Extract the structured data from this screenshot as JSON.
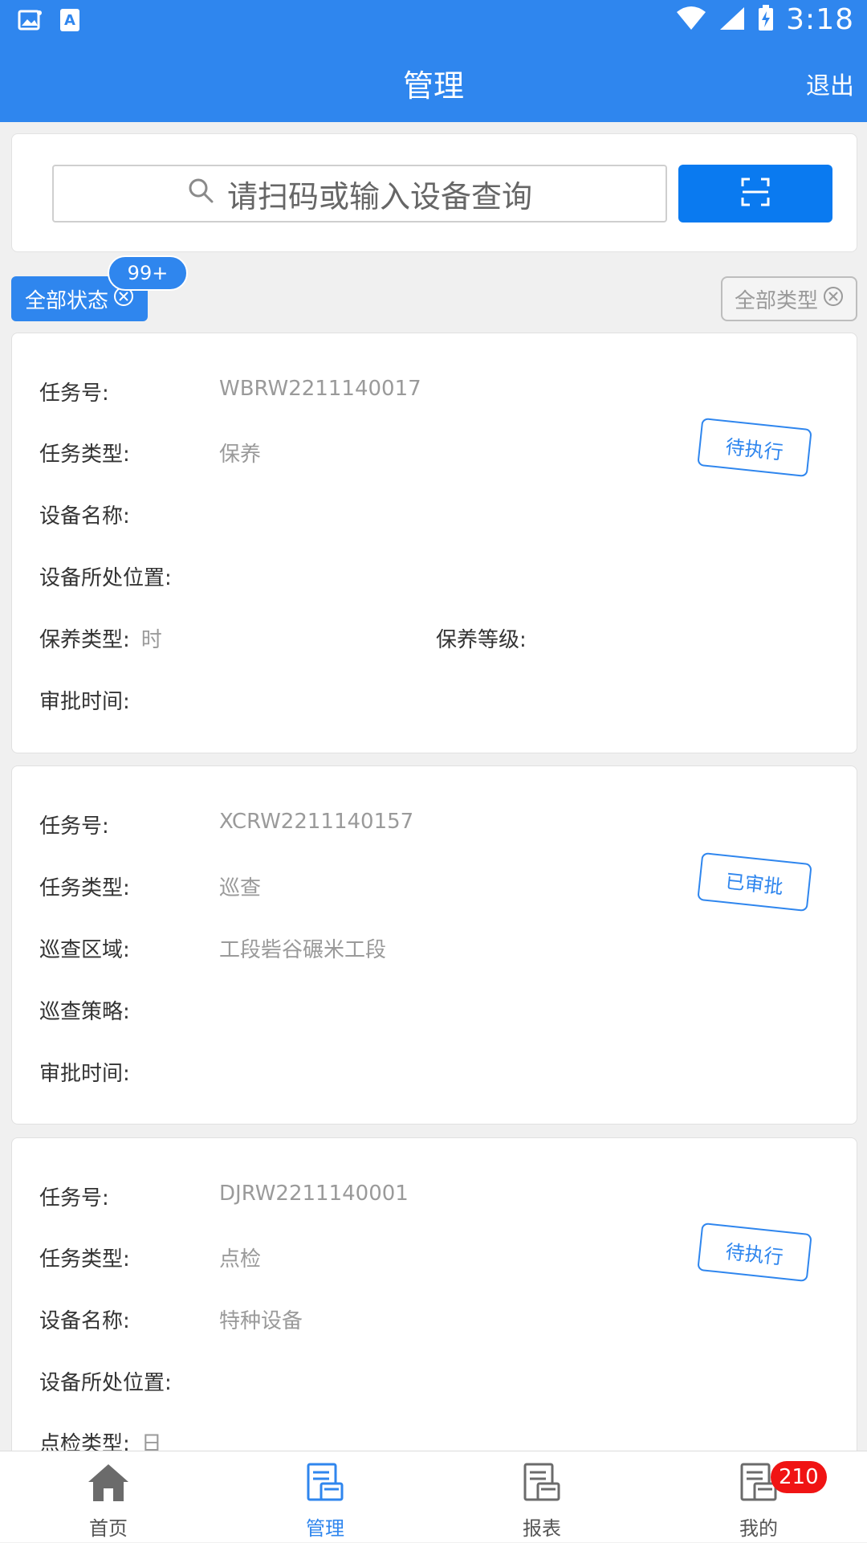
{
  "status_bar": {
    "time": "3:18",
    "icons": [
      "gallery-icon",
      "app-store-icon",
      "wifi-icon",
      "cellular-signal-icon",
      "battery-charging-icon"
    ]
  },
  "header": {
    "title": "管理",
    "logout_label": "退出"
  },
  "search": {
    "placeholder": "请扫码或输入设备查询",
    "icon": "search-icon",
    "scan_icon": "scan-frame-icon"
  },
  "filters": {
    "status_chip": "全部状态",
    "status_badge": "99+",
    "type_chip": "全部类型"
  },
  "tasks": [
    {
      "fields": [
        {
          "label": "任务号:",
          "value": "WBRW2211140017"
        },
        {
          "label": "任务类型:",
          "value": "保养"
        },
        {
          "label": "设备名称:",
          "value": ""
        },
        {
          "label": "设备所处位置:",
          "value": ""
        }
      ],
      "split_row": {
        "left_label": "保养类型:",
        "left_value": "时",
        "right_label": "保养等级:",
        "right_value": ""
      },
      "last_row": {
        "label": "审批时间:",
        "value": ""
      },
      "status": "待执行"
    },
    {
      "fields": [
        {
          "label": "任务号:",
          "value": "XCRW2211140157"
        },
        {
          "label": "任务类型:",
          "value": "巡查"
        },
        {
          "label": "巡查区域:",
          "value": "工段砦谷碾米工段"
        },
        {
          "label": "巡查策略:",
          "value": ""
        },
        {
          "label": "审批时间:",
          "value": ""
        }
      ],
      "status": "已审批"
    },
    {
      "fields": [
        {
          "label": "任务号:",
          "value": "DJRW2211140001"
        },
        {
          "label": "任务类型:",
          "value": "点检"
        },
        {
          "label": "设备名称:",
          "value": "特种设备"
        },
        {
          "label": "设备所处位置:",
          "value": ""
        }
      ],
      "partial_row": {
        "label": "点检类型:",
        "value": "日"
      },
      "status": "待执行"
    }
  ],
  "bottom_nav": {
    "items": [
      {
        "label": "首页",
        "icon": "home-icon",
        "active": false
      },
      {
        "label": "管理",
        "icon": "manage-doc-icon",
        "active": true
      },
      {
        "label": "报表",
        "icon": "report-doc-icon",
        "active": false
      },
      {
        "label": "我的",
        "icon": "profile-doc-icon",
        "active": false,
        "badge": "210"
      }
    ]
  },
  "colors": {
    "primary": "#2f86ee",
    "scan_button": "#0a7af0",
    "badge_red": "#f01414",
    "text_value": "#9a9a9a"
  }
}
